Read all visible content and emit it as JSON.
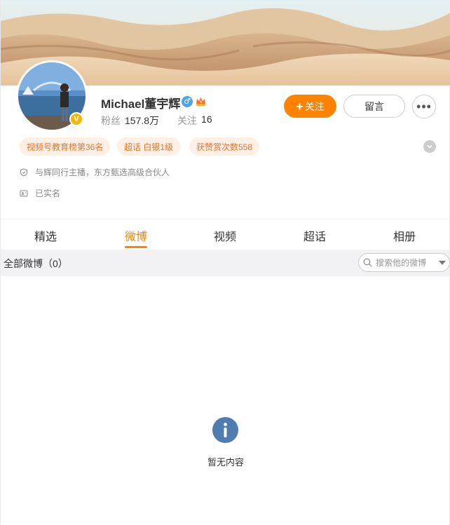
{
  "profile": {
    "name": "Michael董宇辉",
    "fans_label": "粉丝",
    "fans_count": "157.8万",
    "following_label": "关注",
    "following_count": "16",
    "verified_badge": "V"
  },
  "actions": {
    "follow_label": "关注",
    "message_label": "留言",
    "more_label": "•••"
  },
  "tags": [
    {
      "label": "视频号教育榜第36名"
    },
    {
      "label": "超话 白银1级"
    },
    {
      "label": "获赞赏次数558"
    }
  ],
  "info": {
    "description": "与辉同行主播，东方甄选高级合伙人",
    "verification": "已实名"
  },
  "tabs": [
    {
      "label": "精选"
    },
    {
      "label": "微博"
    },
    {
      "label": "视频"
    },
    {
      "label": "超话"
    },
    {
      "label": "相册"
    }
  ],
  "active_tab": "微博",
  "feed": {
    "filter_label": "全部微博（0）",
    "search_placeholder": "搜索他的微博",
    "empty_text": "暂无内容"
  },
  "colors": {
    "accent": "#ff8200",
    "tag_bg": "#fff0e6",
    "tag_text": "#e8712a",
    "info_icon": "#4f7db0"
  },
  "icons": {
    "gender": "male-icon",
    "crown": "crown-icon",
    "expand": "chevron-down-icon",
    "shield": "shield-icon",
    "id_card": "id-card-icon",
    "search": "search-icon",
    "empty": "info-icon"
  }
}
